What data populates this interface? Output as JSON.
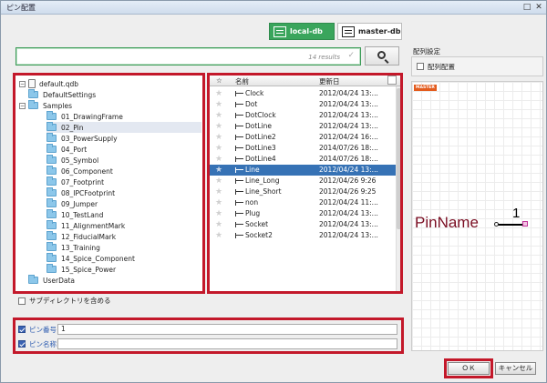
{
  "window": {
    "title": "ピン配置",
    "min_glyph": "□",
    "close_glyph": "✕"
  },
  "db": {
    "local_label": "local-db",
    "master_label": "master-db"
  },
  "search": {
    "results": "14 results",
    "value": ""
  },
  "tree": {
    "root": "default.qdb",
    "items": [
      {
        "label": "DefaultSettings",
        "level": 1
      },
      {
        "label": "Samples",
        "level": 1,
        "expanded": true
      },
      {
        "label": "01_DrawingFrame",
        "level": 2
      },
      {
        "label": "02_Pin",
        "level": 2,
        "selected": true
      },
      {
        "label": "03_PowerSupply",
        "level": 2
      },
      {
        "label": "04_Port",
        "level": 2
      },
      {
        "label": "05_Symbol",
        "level": 2
      },
      {
        "label": "06_Component",
        "level": 2
      },
      {
        "label": "07_Footprint",
        "level": 2
      },
      {
        "label": "08_IPCFootprint",
        "level": 2
      },
      {
        "label": "09_Jumper",
        "level": 2
      },
      {
        "label": "10_TestLand",
        "level": 2
      },
      {
        "label": "11_AlignmentMark",
        "level": 2
      },
      {
        "label": "12_FiducialMark",
        "level": 2
      },
      {
        "label": "13_Training",
        "level": 2
      },
      {
        "label": "14_Spice_Component",
        "level": 2
      },
      {
        "label": "15_Spice_Power",
        "level": 2
      },
      {
        "label": "UserData",
        "level": 1
      }
    ]
  },
  "list": {
    "headers": {
      "star": "☆",
      "name": "名前",
      "date": "更新日"
    },
    "rows": [
      {
        "name": "Clock",
        "date": "2012/04/24 13:..."
      },
      {
        "name": "Dot",
        "date": "2012/04/24 13:..."
      },
      {
        "name": "DotClock",
        "date": "2012/04/24 13:..."
      },
      {
        "name": "DotLine",
        "date": "2012/04/24 13:..."
      },
      {
        "name": "DotLine2",
        "date": "2012/04/24 16:..."
      },
      {
        "name": "DotLine3",
        "date": "2014/07/26 18:..."
      },
      {
        "name": "DotLine4",
        "date": "2014/07/26 18:..."
      },
      {
        "name": "Line",
        "date": "2012/04/24 13:...",
        "selected": true
      },
      {
        "name": "Line_Long",
        "date": "2012/04/26 9:26"
      },
      {
        "name": "Line_Short",
        "date": "2012/04/26 9:25"
      },
      {
        "name": "non",
        "date": "2012/04/24 11:..."
      },
      {
        "name": "Plug",
        "date": "2012/04/24 13:..."
      },
      {
        "name": "Socket",
        "date": "2012/04/24 13:..."
      },
      {
        "name": "Socket2",
        "date": "2012/04/24 13:..."
      }
    ]
  },
  "subdir_label": "サブディレクトリを含める",
  "fields": {
    "pin_number_label": "ピン番号",
    "pin_number_value": "1",
    "pin_name_label": "ピン名称",
    "pin_name_value": ""
  },
  "array": {
    "section_label": "配列設定",
    "checkbox_label": "配列配置"
  },
  "preview": {
    "badge": "MASTER",
    "pin_name": "PinName",
    "pin_number": "1"
  },
  "buttons": {
    "ok": "ＯＫ",
    "cancel": "キャンセル"
  },
  "colors": {
    "highlight": "#c3182a",
    "local_db": "#3aa55c",
    "selection": "#3672b5"
  }
}
